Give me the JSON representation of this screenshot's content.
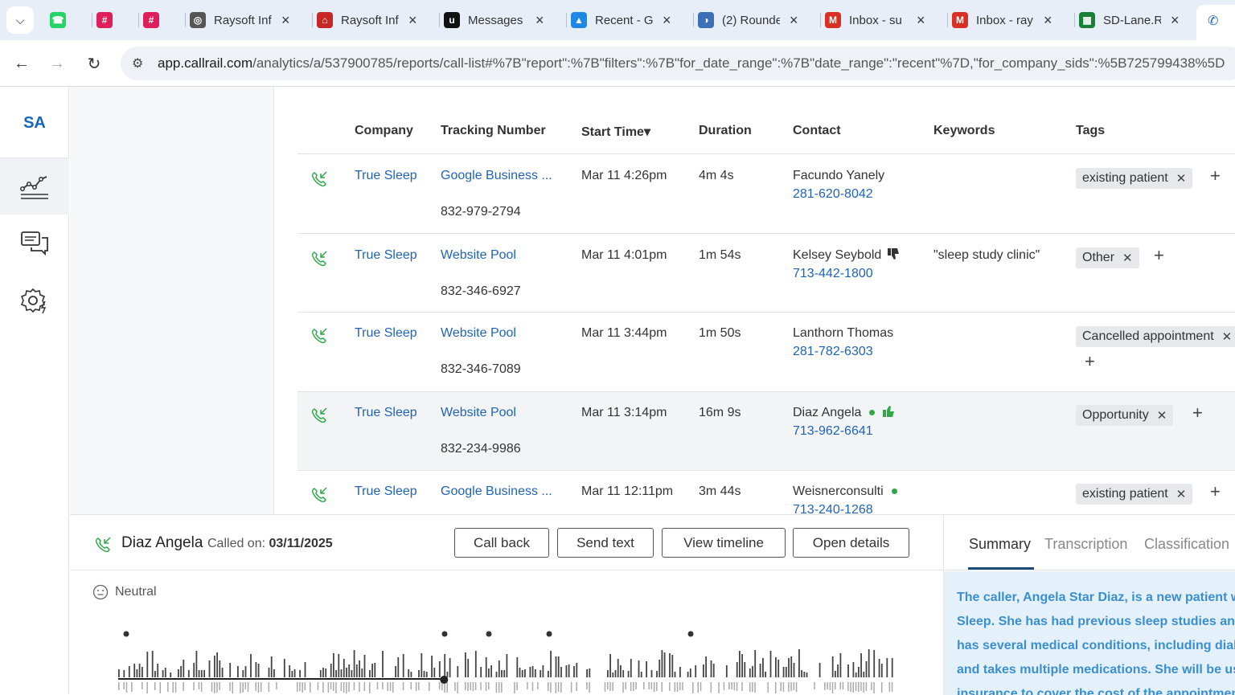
{
  "browser": {
    "tabs": [
      {
        "title": "",
        "icon": "whatsapp-icon",
        "color": "#25d366"
      },
      {
        "title": "",
        "icon": "slack-icon",
        "color": "#e01e5a"
      },
      {
        "title": "",
        "icon": "slack-icon",
        "color": "#e01e5a"
      },
      {
        "title": "Raysoft Inf",
        "icon": "globe-icon",
        "color": "#555555"
      },
      {
        "title": "Raysoft Inf",
        "icon": "graduation-icon",
        "color": "#c62828"
      },
      {
        "title": "Messages",
        "icon": "upwork-icon",
        "color": "#111111"
      },
      {
        "title": "Recent - G",
        "icon": "drive-icon",
        "color": "#1e88e5"
      },
      {
        "title": "(2) Rounde",
        "icon": "roundcube-icon",
        "color": "#3b6fb6"
      },
      {
        "title": "Inbox - su",
        "icon": "gmail-icon",
        "color": "#d93025"
      },
      {
        "title": "Inbox - ray",
        "icon": "gmail-icon",
        "color": "#d93025"
      },
      {
        "title": "SD-Lane.R",
        "icon": "sheets-icon",
        "color": "#188038"
      }
    ],
    "url_host": "app.callrail.com",
    "url_path": "/analytics/a/537900785/reports/call-list#%7B\"report\":%7B\"filters\":%7B\"for_date_range\":%7B\"date_range\":\"recent\"%7D,\"for_company_sids\":%5B725799438%5D"
  },
  "nav": {
    "avatar": "SA"
  },
  "table": {
    "headers": {
      "company": "Company",
      "tracking": "Tracking Number",
      "start": "Start Time▾",
      "duration": "Duration",
      "contact": "Contact",
      "keywords": "Keywords",
      "tags": "Tags"
    },
    "rows": [
      {
        "company": "True Sleep",
        "tracking": "Google Business ...",
        "tracking_number": "832-979-2794",
        "start": "Mar 11 4:26pm",
        "duration": "4m 4s",
        "contact": "Facundo Yanely",
        "contact_phone": "281-620-8042",
        "keywords": "",
        "tag": "existing patient"
      },
      {
        "company": "True Sleep",
        "tracking": "Website Pool",
        "tracking_number": "832-346-6927",
        "start": "Mar 11 4:01pm",
        "duration": "1m 54s",
        "contact": "Kelsey Seybold",
        "contact_phone": "713-442-1800",
        "keywords": "\"sleep study clinic\"",
        "tag": "Other"
      },
      {
        "company": "True Sleep",
        "tracking": "Website Pool",
        "tracking_number": "832-346-7089",
        "start": "Mar 11 3:44pm",
        "duration": "1m 50s",
        "contact": "Lanthorn Thomas",
        "contact_phone": "281-782-6303",
        "keywords": "",
        "tag": "Cancelled appointment"
      },
      {
        "company": "True Sleep",
        "tracking": "Website Pool",
        "tracking_number": "832-234-9986",
        "start": "Mar 11 3:14pm",
        "duration": "16m 9s",
        "contact": "Diaz Angela",
        "contact_phone": "713-962-6641",
        "keywords": "",
        "tag": "Opportunity"
      },
      {
        "company": "True Sleep",
        "tracking": "Google Business ...",
        "tracking_number": "",
        "start": "Mar 11 12:11pm",
        "duration": "3m 44s",
        "contact": "Weisnerconsulti",
        "contact_phone": "713-240-1268",
        "keywords": "",
        "tag": "existing patient"
      }
    ]
  },
  "detail": {
    "caller": "Diaz Angela",
    "called_on_label": "Called on:",
    "called_on_date": "03/11/2025",
    "buttons": {
      "call_back": "Call back",
      "send_text": "Send text",
      "view_timeline": "View timeline",
      "open_details": "Open details"
    },
    "sentiment": "Neutral",
    "playback_fraction": 0.42,
    "tabs": {
      "summary": "Summary",
      "transcription": "Transcription",
      "classification": "Classification"
    },
    "summary_lines": [
      "The caller, Angela Star Diaz, is a new patient wh",
      "Sleep. She has had previous sleep studies and",
      "has several medical conditions, including diabe",
      "and takes multiple medications. She will be us",
      "insurance to cover the cost of the appointmen"
    ]
  },
  "colors": {
    "link": "#1f63b8",
    "call_icon": "#2ea84a",
    "summary_text": "#3a8fd0",
    "summary_bg": "#e4f0fa"
  }
}
